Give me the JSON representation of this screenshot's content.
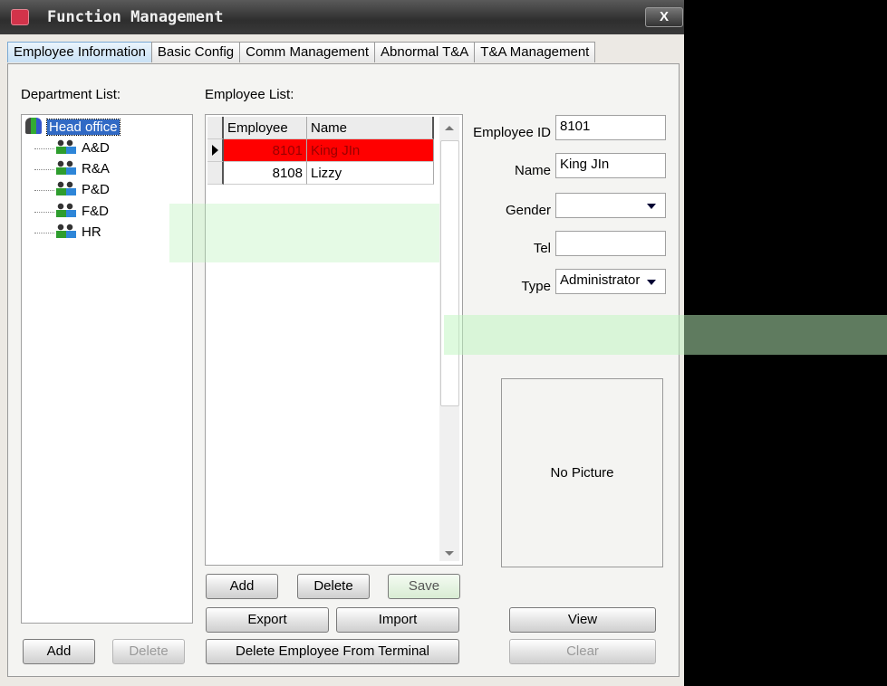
{
  "window": {
    "title": "Function Management",
    "close_label": "X"
  },
  "tabs": [
    {
      "label": "Employee Information",
      "active": true
    },
    {
      "label": "Basic Config"
    },
    {
      "label": "Comm Management"
    },
    {
      "label": "Abnormal T&A"
    },
    {
      "label": "T&A Management"
    }
  ],
  "departments": {
    "label": "Department List:",
    "root": "Head office",
    "children": [
      "A&D",
      "R&A",
      "P&D",
      "F&D",
      "HR"
    ],
    "add_label": "Add",
    "delete_label": "Delete"
  },
  "employees": {
    "label": "Employee List:",
    "columns": [
      "Employee ID",
      "Name"
    ],
    "rows": [
      {
        "id": "8101",
        "name": "King JIn",
        "selected": true
      },
      {
        "id": "8108",
        "name": "Lizzy"
      }
    ],
    "add_label": "Add",
    "delete_label": "Delete",
    "save_label": "Save",
    "export_label": "Export",
    "import_label": "Import",
    "delete_terminal_label": "Delete Employee From Terminal"
  },
  "details": {
    "id_label": "Employee ID",
    "id_value": "8101",
    "name_label": "Name",
    "name_value": "King JIn",
    "gender_label": "Gender",
    "gender_value": "",
    "tel_label": "Tel",
    "tel_value": "",
    "type_label": "Type",
    "type_value": "Administrator",
    "picture_text": "No Picture",
    "view_label": "View",
    "clear_label": "Clear"
  },
  "colors": {
    "selected_row": "#ff0000",
    "tree_selection": "#316ac5"
  }
}
